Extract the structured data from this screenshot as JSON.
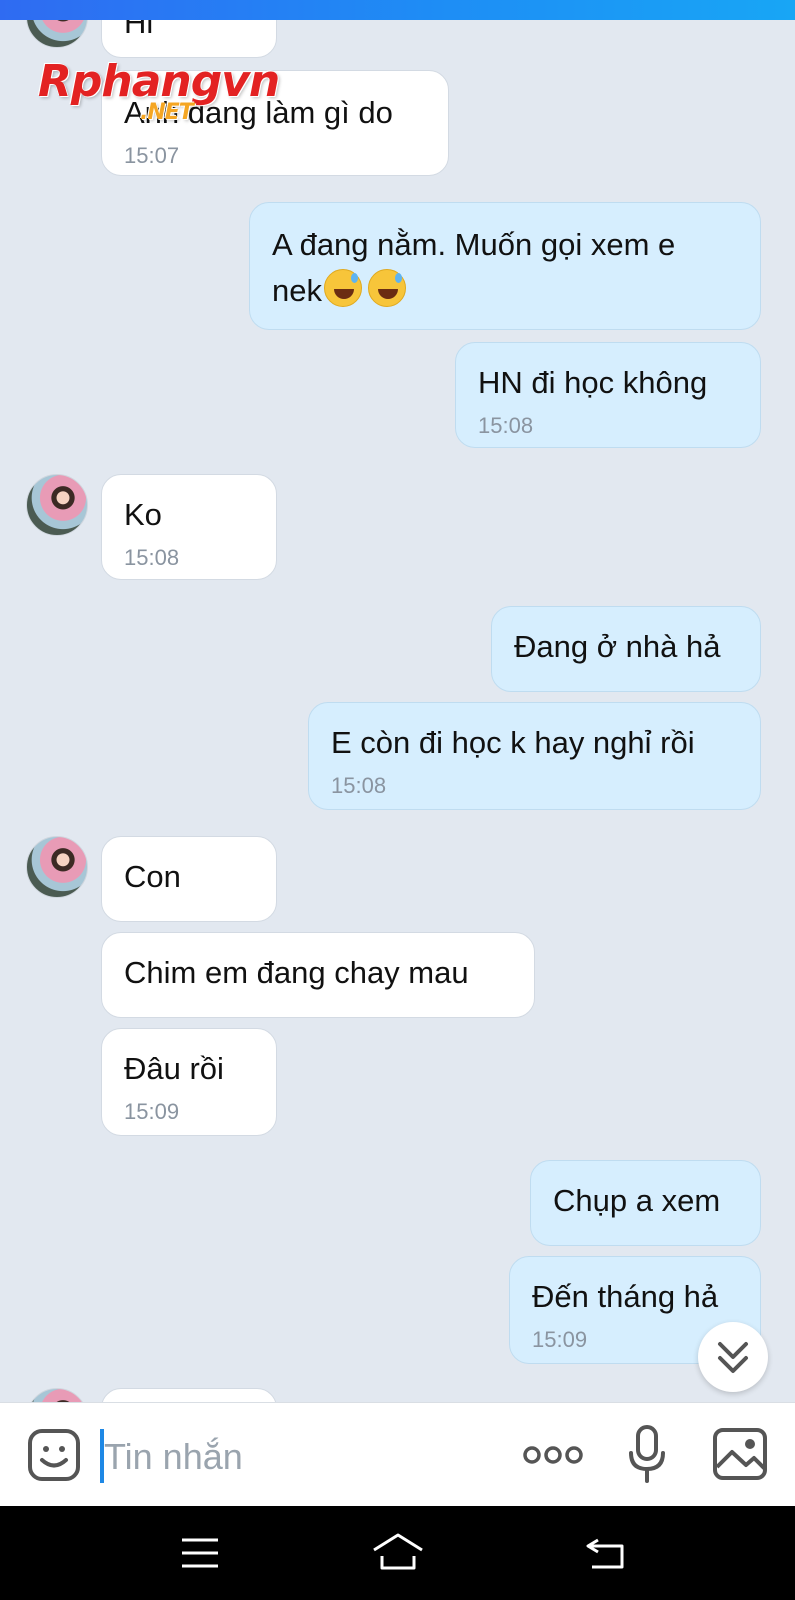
{
  "watermark": {
    "main": "Rphangvn",
    "suffix": ".NET"
  },
  "messages": [
    {
      "side": "in",
      "text": "Hi",
      "time": ""
    },
    {
      "side": "in",
      "text": "Anh đang làm gì do",
      "time": "15:07"
    },
    {
      "side": "out",
      "text_line1": "A đang nằm. Muốn gọi xem e",
      "text_line2": "nek",
      "time": ""
    },
    {
      "side": "out",
      "text": "HN đi học không",
      "time": "15:08"
    },
    {
      "side": "in",
      "text": "Ko",
      "time": "15:08"
    },
    {
      "side": "out",
      "text": "Đang ở nhà hả",
      "time": ""
    },
    {
      "side": "out",
      "text": "E còn đi học k hay nghỉ rồi",
      "time": "15:08"
    },
    {
      "side": "in",
      "text": "Con",
      "time": ""
    },
    {
      "side": "in",
      "text": "Chim em đang chay mau",
      "time": ""
    },
    {
      "side": "in",
      "text": "Đâu rồi",
      "time": "15:09"
    },
    {
      "side": "out",
      "text": "Chụp a xem",
      "time": ""
    },
    {
      "side": "out",
      "text": "Đến tháng hả",
      "time": "15:09"
    }
  ],
  "input": {
    "placeholder": "Tin nhắn"
  },
  "icons": {
    "emoji": "emoji-icon",
    "more": "more-icon",
    "mic": "microphone-icon",
    "image": "image-icon",
    "scroll": "double-chevron-down-icon",
    "nav_menu": "menu-icon",
    "nav_home": "home-icon",
    "nav_back": "back-icon"
  },
  "colors": {
    "background": "#e2e8f0",
    "incoming_bubble": "#ffffff",
    "outgoing_bubble": "#d6eefe",
    "accent": "#1e88e5"
  }
}
